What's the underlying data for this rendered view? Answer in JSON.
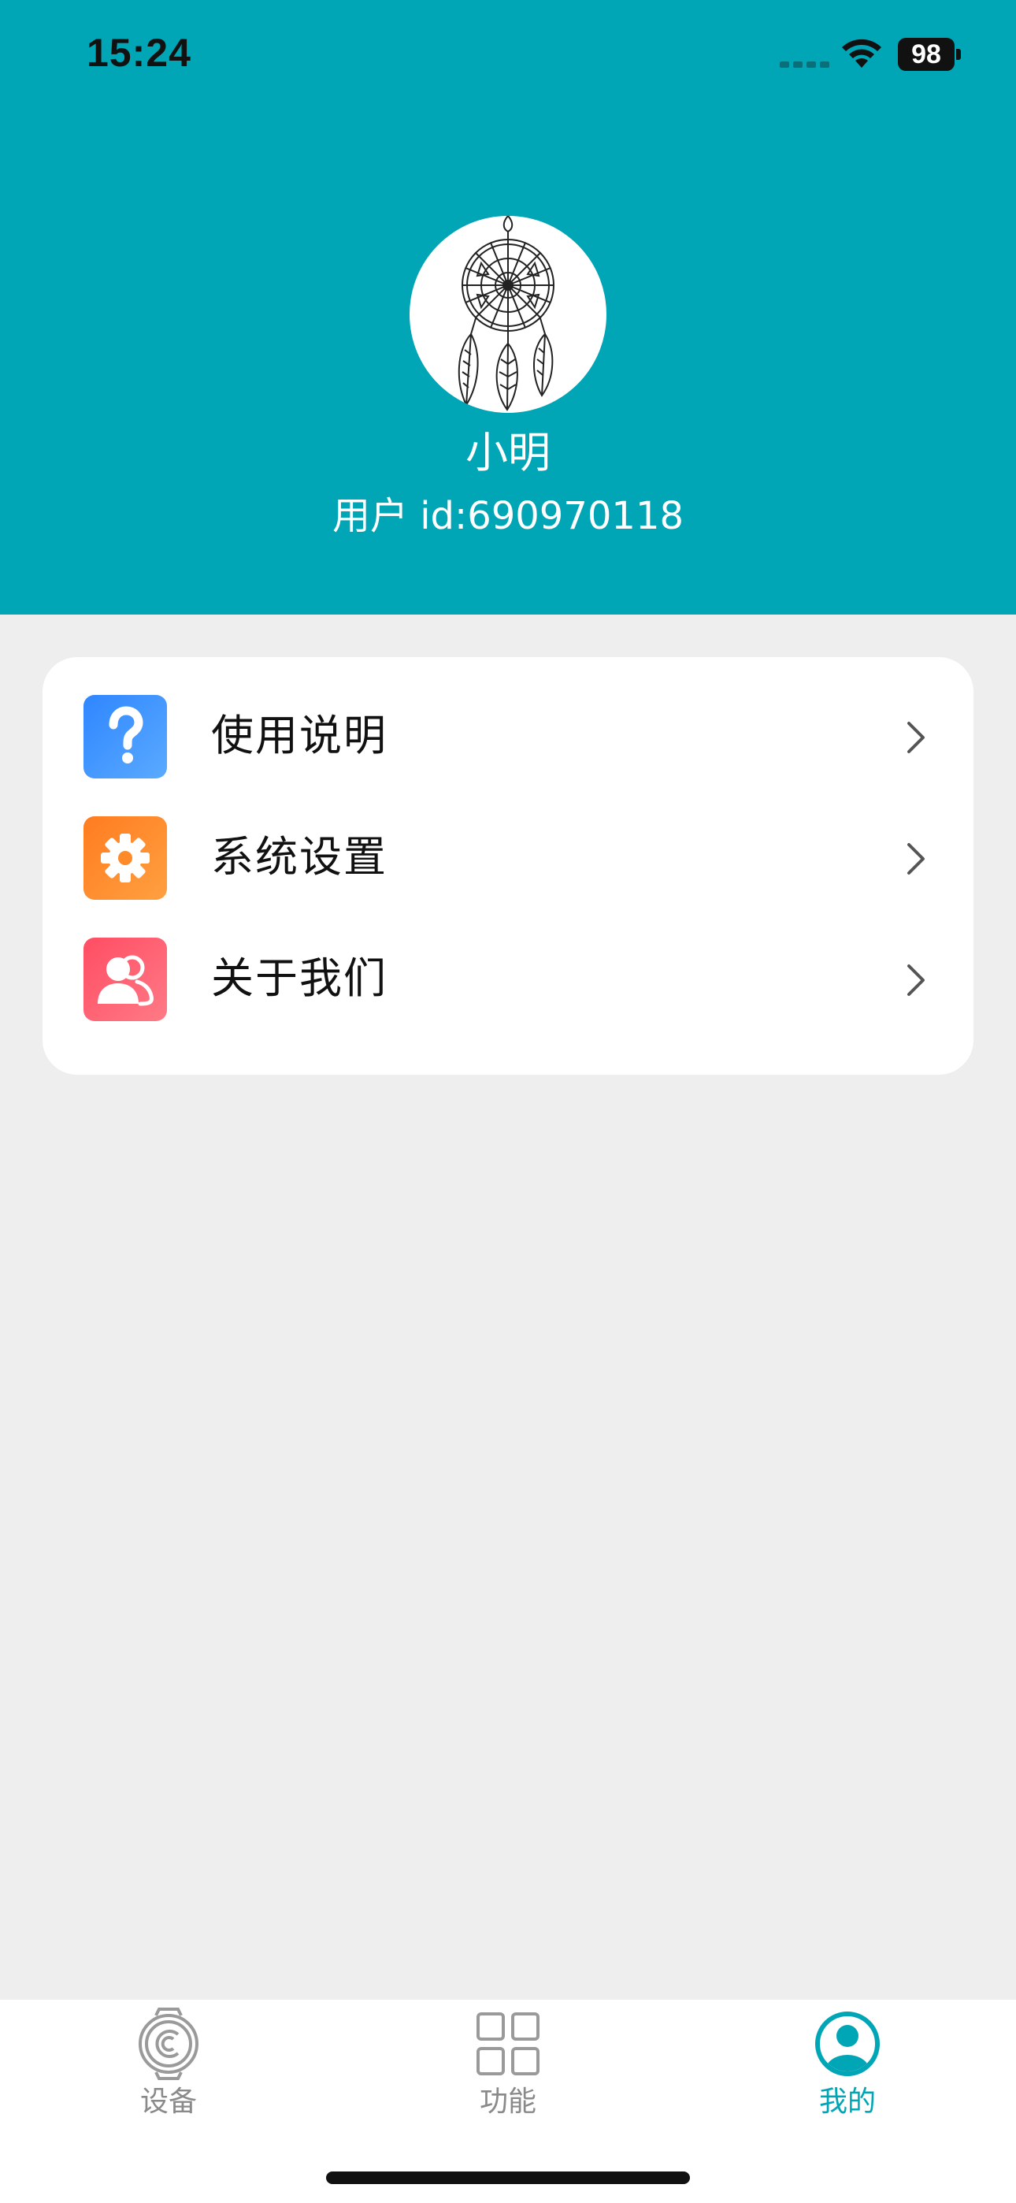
{
  "status_bar": {
    "time": "15:24",
    "battery": "98"
  },
  "profile": {
    "name": "小明",
    "user_id_prefix": "用户 id:",
    "user_id": "690970118"
  },
  "menu": {
    "items": [
      {
        "label": "使用说明",
        "icon": "question-icon",
        "color": "#3a8dff"
      },
      {
        "label": "系统设置",
        "icon": "gear-icon",
        "color": "#ff8a2a"
      },
      {
        "label": "关于我们",
        "icon": "users-icon",
        "color": "#ff5a6e"
      }
    ]
  },
  "tabbar": {
    "tabs": [
      {
        "label": "设备",
        "icon": "watch-icon",
        "active": false
      },
      {
        "label": "功能",
        "icon": "grid-icon",
        "active": false
      },
      {
        "label": "我的",
        "icon": "user-circle-icon",
        "active": true
      }
    ]
  },
  "theme": {
    "primary": "#00a5b6",
    "background": "#eeeeee",
    "inactive": "#8a8a8a"
  }
}
